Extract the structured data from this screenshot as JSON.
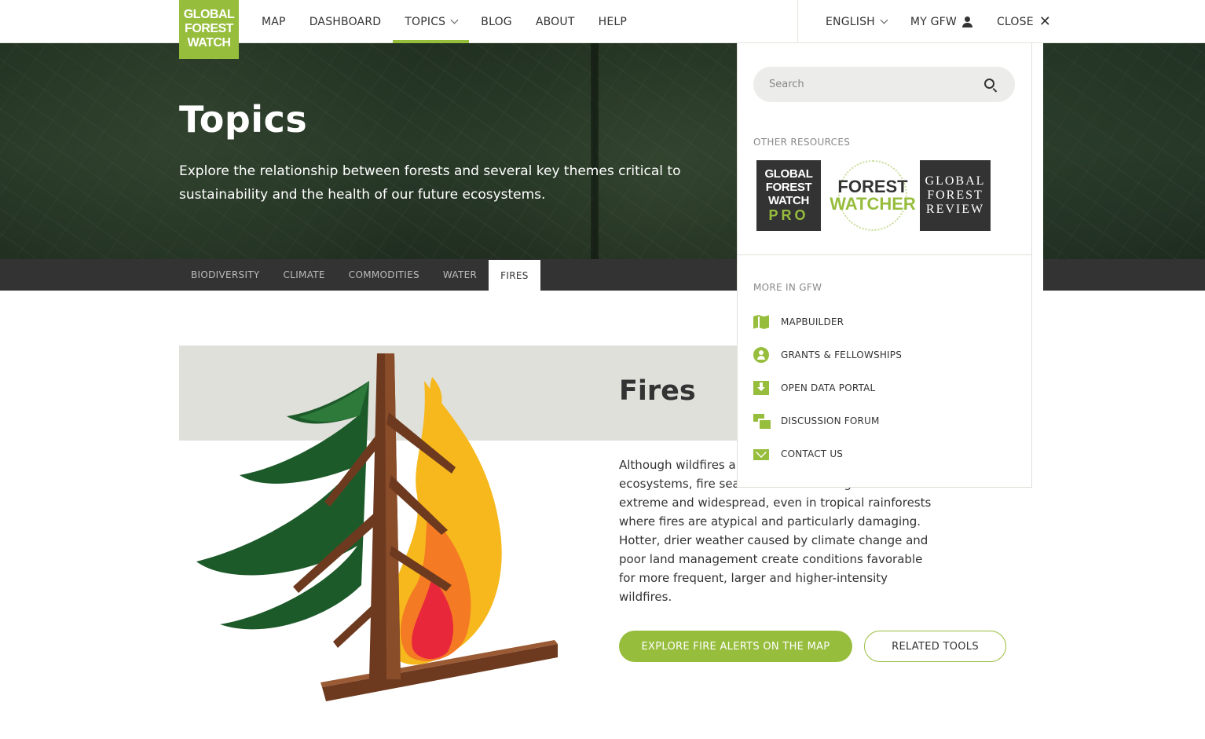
{
  "logo": {
    "lines": [
      "GLOBAL",
      "FOREST",
      "WATCH"
    ]
  },
  "nav": {
    "items": [
      "MAP",
      "DASHBOARD",
      "TOPICS",
      "BLOG",
      "ABOUT",
      "HELP"
    ],
    "language": "ENGLISH",
    "my_gfw": "MY GFW",
    "close": "CLOSE"
  },
  "hero": {
    "title": "Topics",
    "description": "Explore the relationship between forests and several key themes critical to sustainability and the health of our future ecosystems."
  },
  "tabs": [
    "BIODIVERSITY",
    "CLIMATE",
    "COMMODITIES",
    "WATER",
    "FIRES"
  ],
  "topic": {
    "title": "Fires",
    "description": "Although wildfires are a natural part of some forest ecosystems, fire seasons are becoming more extreme and widespread, even in tropical rainforests where fires are atypical and particularly damaging. Hotter, drier weather caused by climate change and poor land management create conditions favorable for more frequent, larger and higher-intensity wildfires.",
    "primary_button": "EXPLORE FIRE ALERTS ON THE MAP",
    "secondary_button": "RELATED TOOLS"
  },
  "panel": {
    "search_placeholder": "Search",
    "other_resources_label": "OTHER RESOURCES",
    "resources": {
      "pro": {
        "lines": [
          "GLOBAL",
          "FOREST",
          "WATCH"
        ],
        "badge": "PRO"
      },
      "watcher": {
        "line1": "FOREST",
        "line2": "WATCHER"
      },
      "review": {
        "lines": [
          "GLOBAL",
          "FOREST",
          "REVIEW"
        ]
      }
    },
    "more_label": "MORE IN GFW",
    "more_items": [
      {
        "label": "MAPBUILDER",
        "icon": "map-icon"
      },
      {
        "label": "GRANTS & FELLOWSHIPS",
        "icon": "user-circle-icon"
      },
      {
        "label": "OPEN DATA PORTAL",
        "icon": "download-icon"
      },
      {
        "label": "DISCUSSION FORUM",
        "icon": "forum-icon"
      },
      {
        "label": "CONTACT US",
        "icon": "mail-icon"
      }
    ]
  },
  "colors": {
    "brand_green": "#97bd3d",
    "dark": "#333333"
  }
}
